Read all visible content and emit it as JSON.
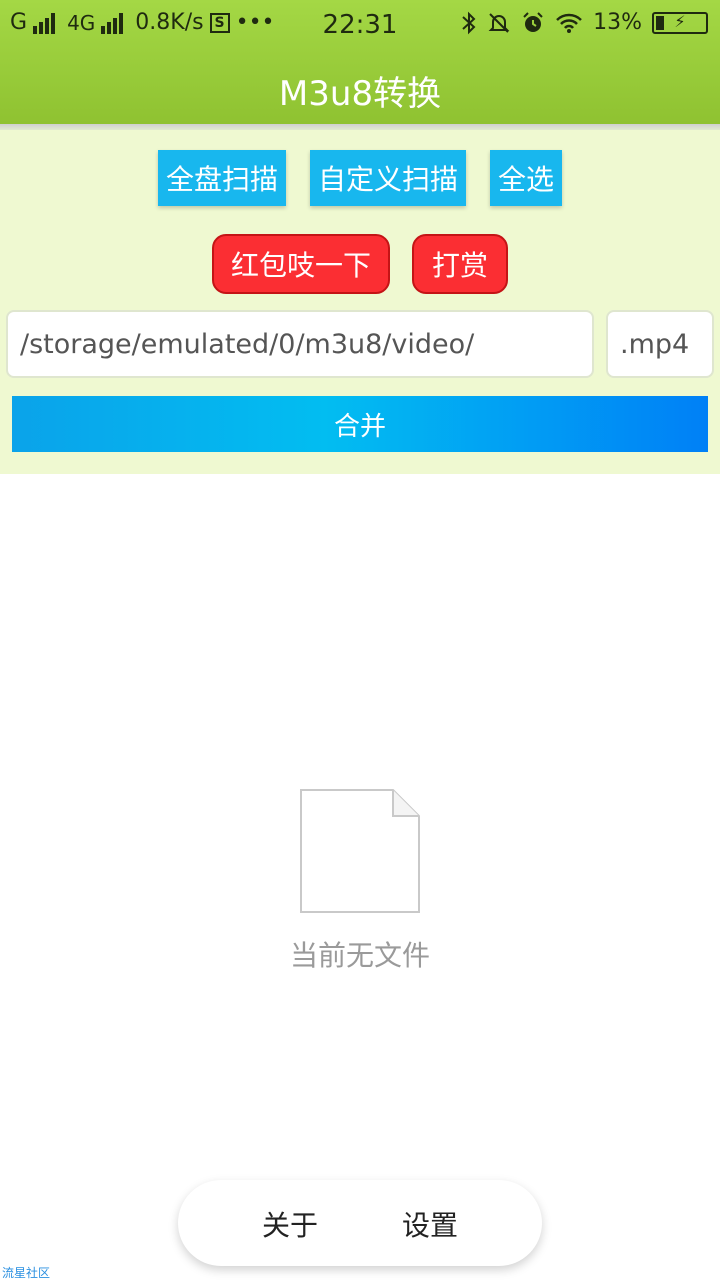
{
  "status_bar": {
    "carrier1": "G",
    "carrier2": "4G",
    "speed": "0.8K/s",
    "s_badge": "S",
    "more": "•••",
    "time": "22:31",
    "bluetooth_icon": "bluetooth-icon",
    "mute_icon": "bell-off-icon",
    "alarm_icon": "alarm-icon",
    "wifi_icon": "wifi-icon",
    "battery_percent": "13%",
    "battery_bolt": "⚡"
  },
  "header": {
    "title": "M3u8转换",
    "color": "#9bd03c"
  },
  "toolbar": {
    "scan_all": "全盘扫描",
    "custom_scan": "自定义扫描",
    "select_all": "全选",
    "red_packet": "红包吱一下",
    "tip": "打赏"
  },
  "inputs": {
    "path_value": "/storage/emulated/0/m3u8/video/",
    "ext_value": ".mp4"
  },
  "merge_button": "合并",
  "empty_state": {
    "icon": "file-icon",
    "text": "当前无文件"
  },
  "bottom_nav": {
    "about": "关于",
    "settings": "设置"
  },
  "watermark": "流星社区",
  "colors": {
    "accent_blue": "#18b7ee",
    "accent_red": "#fb2e33",
    "panel_bg": "#eff9d1"
  }
}
